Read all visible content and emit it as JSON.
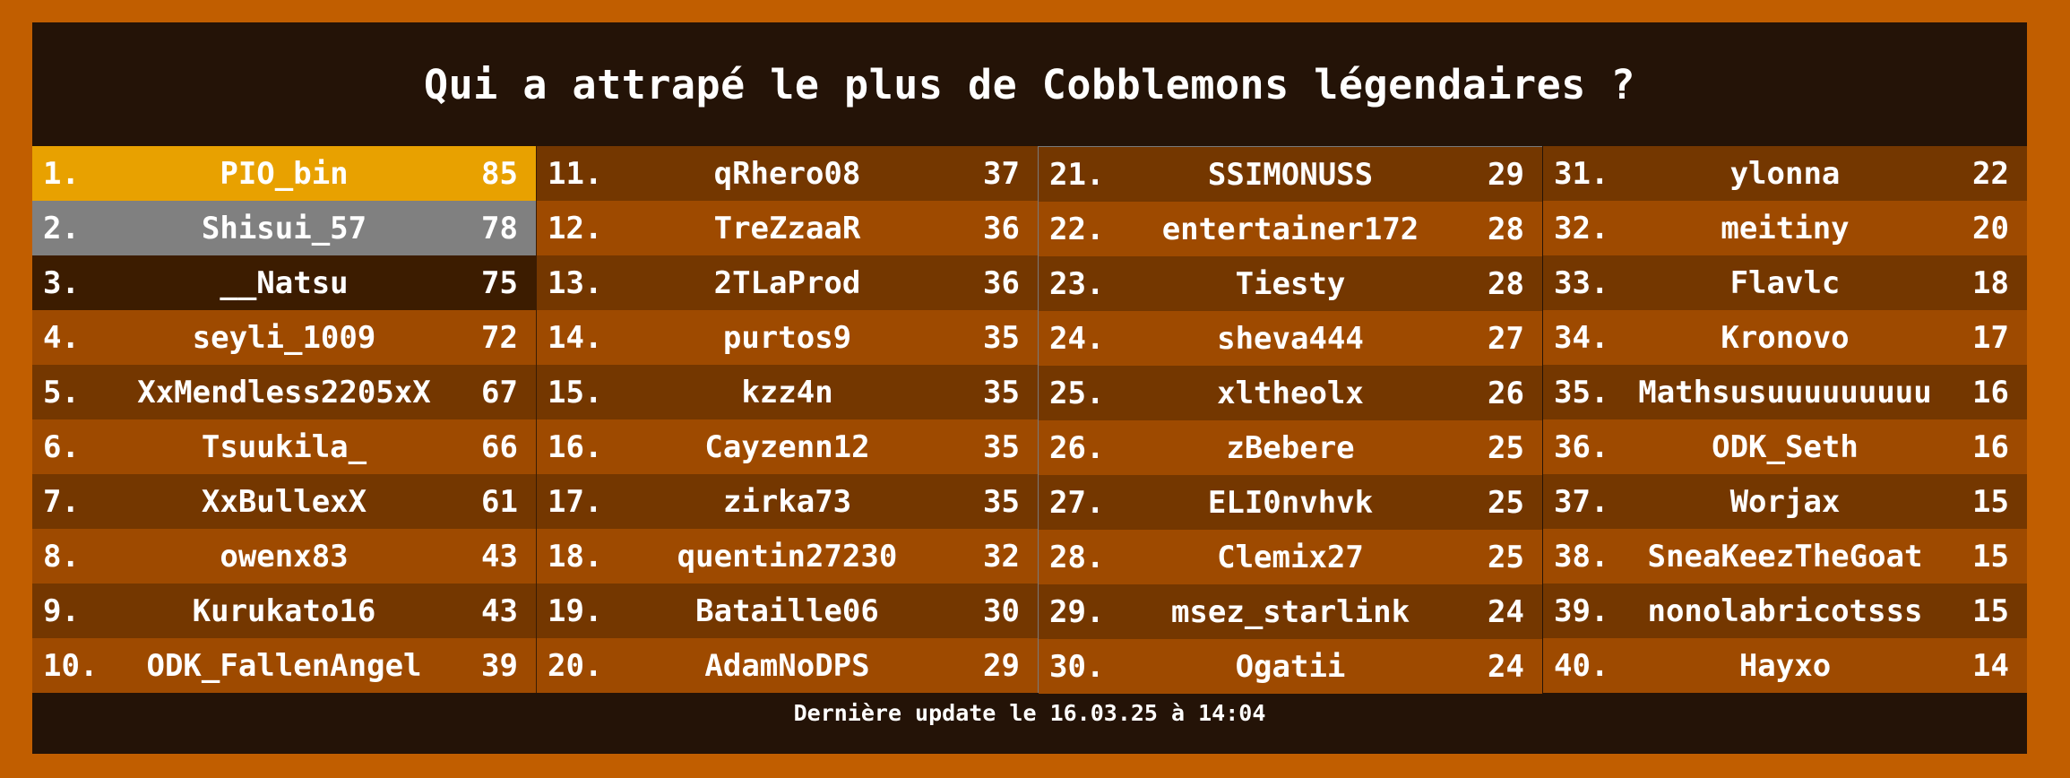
{
  "title": "Qui a attrapé le plus de Cobblemons légendaires ?",
  "footer": "Dernière update le 16.03.25 à 14:04",
  "colors": {
    "frame": "#c15e00",
    "background": "#241307",
    "row_dark": "#743700",
    "row_light": "#9e4a00",
    "gold": "#e8a100",
    "silver": "#808080",
    "bronze": "#3c1c00"
  },
  "columns": [
    [
      {
        "rank": "1.",
        "name": "PIO_bin",
        "score": "85"
      },
      {
        "rank": "2.",
        "name": "Shisui_57",
        "score": "78"
      },
      {
        "rank": "3.",
        "name": "__Natsu",
        "score": "75"
      },
      {
        "rank": "4.",
        "name": "seyli_1009",
        "score": "72"
      },
      {
        "rank": "5.",
        "name": "XxMendless2205xX",
        "score": "67"
      },
      {
        "rank": "6.",
        "name": "Tsuukila_",
        "score": "66"
      },
      {
        "rank": "7.",
        "name": "XxBullexX",
        "score": "61"
      },
      {
        "rank": "8.",
        "name": "owenx83",
        "score": "43"
      },
      {
        "rank": "9.",
        "name": "Kurukato16",
        "score": "43"
      },
      {
        "rank": "10.",
        "name": "ODK_FallenAngel",
        "score": "39"
      }
    ],
    [
      {
        "rank": "11.",
        "name": "qRhero08",
        "score": "37"
      },
      {
        "rank": "12.",
        "name": "TreZzaaR",
        "score": "36"
      },
      {
        "rank": "13.",
        "name": "2TLaProd",
        "score": "36"
      },
      {
        "rank": "14.",
        "name": "purtos9",
        "score": "35"
      },
      {
        "rank": "15.",
        "name": "kzz4n",
        "score": "35"
      },
      {
        "rank": "16.",
        "name": "Cayzenn12",
        "score": "35"
      },
      {
        "rank": "17.",
        "name": "zirka73",
        "score": "35"
      },
      {
        "rank": "18.",
        "name": "quentin27230",
        "score": "32"
      },
      {
        "rank": "19.",
        "name": "Bataille06",
        "score": "30"
      },
      {
        "rank": "20.",
        "name": "AdamNoDPS",
        "score": "29"
      }
    ],
    [
      {
        "rank": "21.",
        "name": "SSIMONUSS",
        "score": "29"
      },
      {
        "rank": "22.",
        "name": "entertainer172",
        "score": "28"
      },
      {
        "rank": "23.",
        "name": "Tiesty",
        "score": "28"
      },
      {
        "rank": "24.",
        "name": "sheva444",
        "score": "27"
      },
      {
        "rank": "25.",
        "name": "xltheolx",
        "score": "26"
      },
      {
        "rank": "26.",
        "name": "zBebere",
        "score": "25"
      },
      {
        "rank": "27.",
        "name": "ELI0nvhvk",
        "score": "25"
      },
      {
        "rank": "28.",
        "name": "Clemix27",
        "score": "25"
      },
      {
        "rank": "29.",
        "name": "msez_starlink",
        "score": "24"
      },
      {
        "rank": "30.",
        "name": "Ogatii",
        "score": "24"
      }
    ],
    [
      {
        "rank": "31.",
        "name": "ylonna",
        "score": "22"
      },
      {
        "rank": "32.",
        "name": "meitiny",
        "score": "20"
      },
      {
        "rank": "33.",
        "name": "Flavlc",
        "score": "18"
      },
      {
        "rank": "34.",
        "name": "Kronovo",
        "score": "17"
      },
      {
        "rank": "35.",
        "name": "Mathsusuuuuuuuuu",
        "score": "16"
      },
      {
        "rank": "36.",
        "name": "ODK_Seth",
        "score": "16"
      },
      {
        "rank": "37.",
        "name": "Worjax",
        "score": "15"
      },
      {
        "rank": "38.",
        "name": "SneaKeezTheGoat",
        "score": "15"
      },
      {
        "rank": "39.",
        "name": "nonolabricotsss",
        "score": "15"
      },
      {
        "rank": "40.",
        "name": "Hayxo",
        "score": "14"
      }
    ]
  ]
}
